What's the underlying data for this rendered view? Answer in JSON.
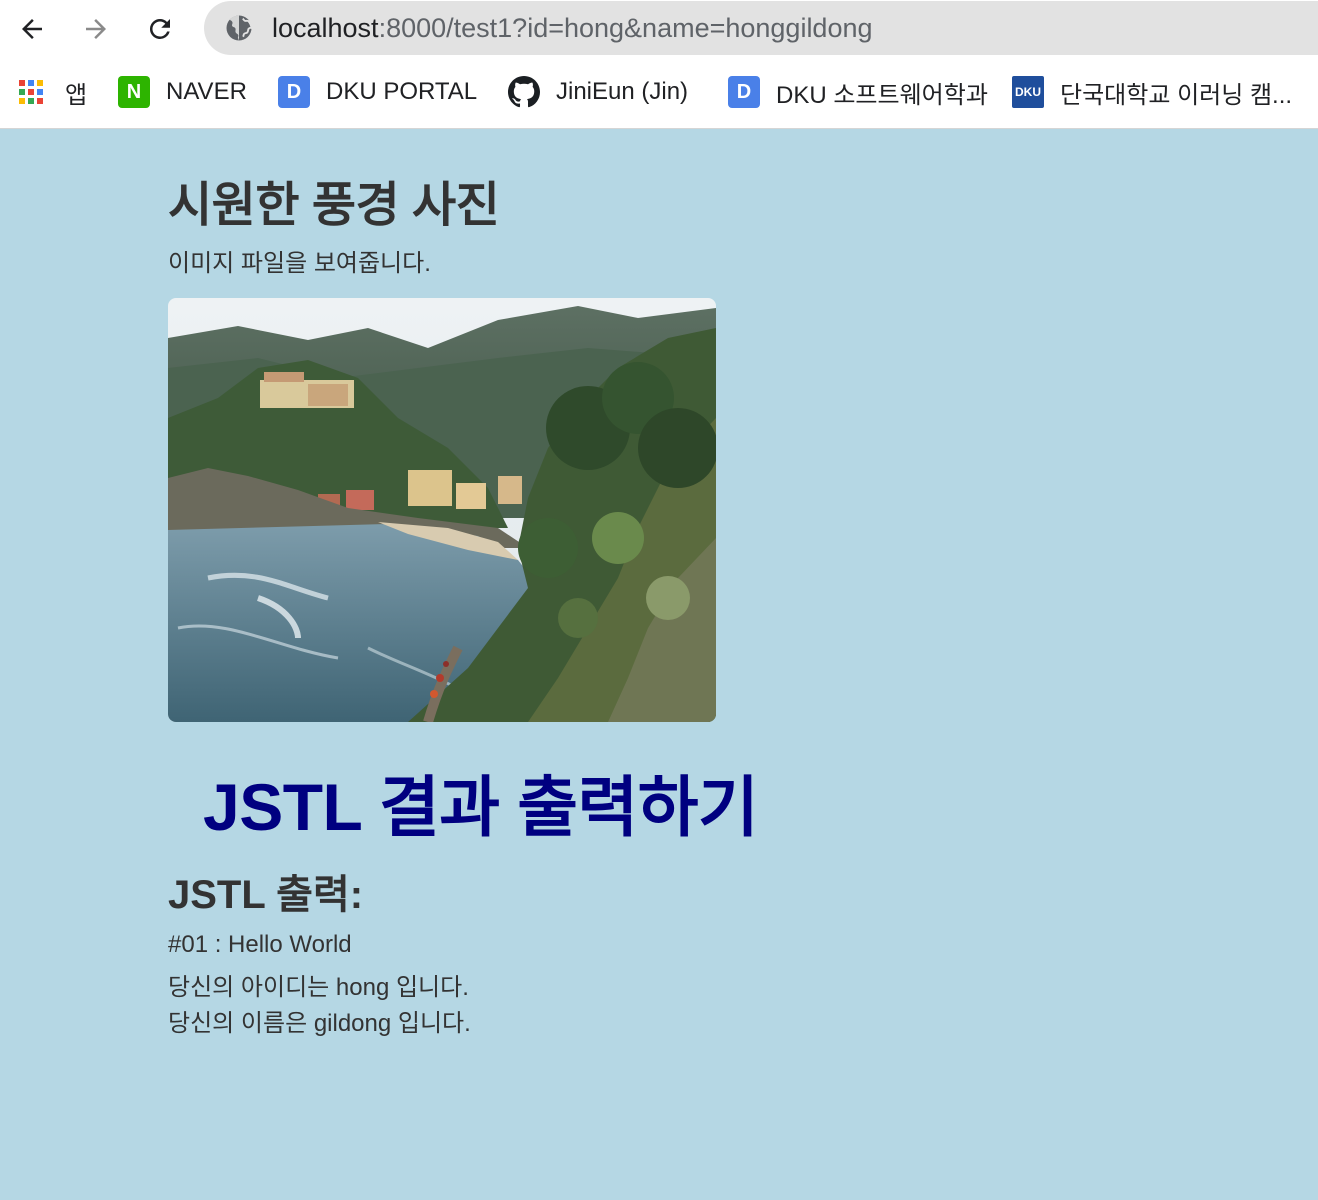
{
  "browser": {
    "url_host": "localhost",
    "url_rest": ":8000/test1?id=hong&name=honggildong",
    "bookmarks": [
      {
        "label": "앱",
        "icon": "apps-grid-icon"
      },
      {
        "label": "NAVER",
        "icon": "naver-icon",
        "glyph": "N",
        "color": "#2db400"
      },
      {
        "label": "DKU PORTAL",
        "icon": "dku-portal-icon",
        "glyph": "D",
        "color": "#4a80e8"
      },
      {
        "label": "JiniEun (Jin)",
        "icon": "github-icon"
      },
      {
        "label": "DKU 소프트웨어학과",
        "icon": "dku-software-icon",
        "glyph": "D",
        "color": "#4a80e8"
      },
      {
        "label": "단국대학교 이러닝 캠...",
        "icon": "dku-elearning-icon",
        "glyph": "DKU",
        "color": "#1f4e9c"
      }
    ]
  },
  "page": {
    "title": "시원한 풍경 사진",
    "description": "이미지 파일을 보여줍니다.",
    "image_alt": "coastal-landscape-photo",
    "heading": "JSTL 결과 출력하기",
    "output_title": "JSTL 출력:",
    "output_lines": [
      "#01 : Hello World",
      "당신의 아이디는 hong 입니다.",
      "당신의 이름은 gildong 입니다."
    ]
  },
  "colors": {
    "page_background": "#b5d7e4",
    "heading_color": "#000080",
    "text_color": "#333333"
  }
}
